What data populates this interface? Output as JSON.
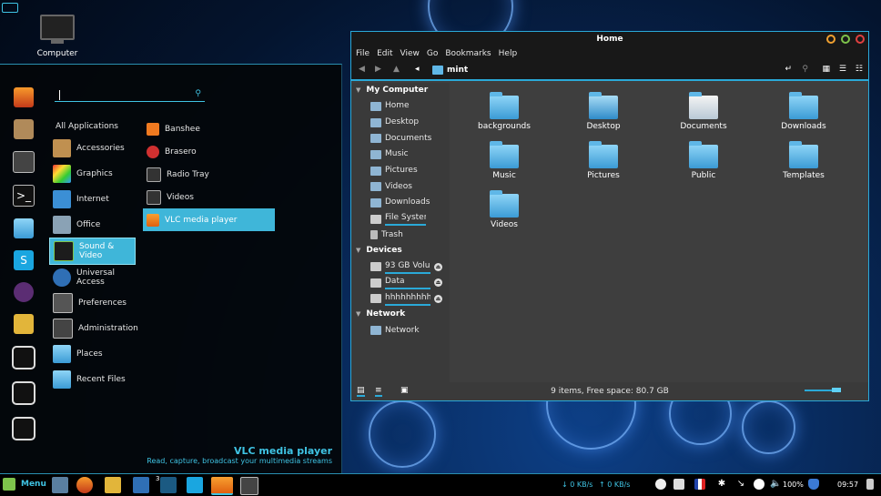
{
  "desktop": {
    "computer_label": "Computer"
  },
  "menu": {
    "search_placeholder": "",
    "all_applications": "All Applications",
    "categories": [
      {
        "label": "Accessories",
        "icon": "accessories-icon"
      },
      {
        "label": "Graphics",
        "icon": "graphics-icon"
      },
      {
        "label": "Internet",
        "icon": "internet-icon"
      },
      {
        "label": "Office",
        "icon": "office-icon"
      },
      {
        "label": "Sound & Video",
        "icon": "sound-video-icon"
      },
      {
        "label": "Universal Access",
        "icon": "accessibility-icon"
      },
      {
        "label": "Preferences",
        "icon": "preferences-icon"
      },
      {
        "label": "Administration",
        "icon": "administration-icon"
      },
      {
        "label": "Places",
        "icon": "places-icon"
      },
      {
        "label": "Recent Files",
        "icon": "recent-files-icon"
      }
    ],
    "apps": [
      {
        "label": "Banshee",
        "icon": "banshee-icon"
      },
      {
        "label": "Brasero",
        "icon": "brasero-icon"
      },
      {
        "label": "Radio Tray",
        "icon": "radio-tray-icon"
      },
      {
        "label": "Videos",
        "icon": "videos-icon"
      },
      {
        "label": "VLC media player",
        "icon": "vlc-icon"
      }
    ],
    "selected_title": "VLC media player",
    "selected_description": "Read, capture, broadcast your multimedia streams"
  },
  "file_manager": {
    "title": "Home",
    "menubar": [
      "File",
      "Edit",
      "View",
      "Go",
      "Bookmarks",
      "Help"
    ],
    "breadcrumb": "mint",
    "sidebar": {
      "my_computer": "My Computer",
      "places": [
        "Home",
        "Desktop",
        "Documents",
        "Music",
        "Pictures",
        "Videos",
        "Downloads",
        "File System",
        "Trash"
      ],
      "devices_header": "Devices",
      "devices": [
        "93 GB Volu...",
        "Data",
        "hhhhhhhhhh"
      ],
      "network_header": "Network",
      "network": [
        "Network"
      ]
    },
    "folders": [
      "backgrounds",
      "Desktop",
      "Documents",
      "Downloads",
      "Music",
      "Pictures",
      "Public",
      "Templates",
      "Videos"
    ],
    "status": "9 items, Free space: 80.7 GB"
  },
  "taskbar": {
    "menu_label": "Menu",
    "workspace_number": "3",
    "net_down": "↓ 0 KB/s",
    "net_up": "↑ 0 KB/s",
    "battery": "100%",
    "clock": "09:57"
  },
  "colors": {
    "accent": "#3fb6d9",
    "bg_dark": "#181818",
    "panel": "#3e3e3e"
  }
}
